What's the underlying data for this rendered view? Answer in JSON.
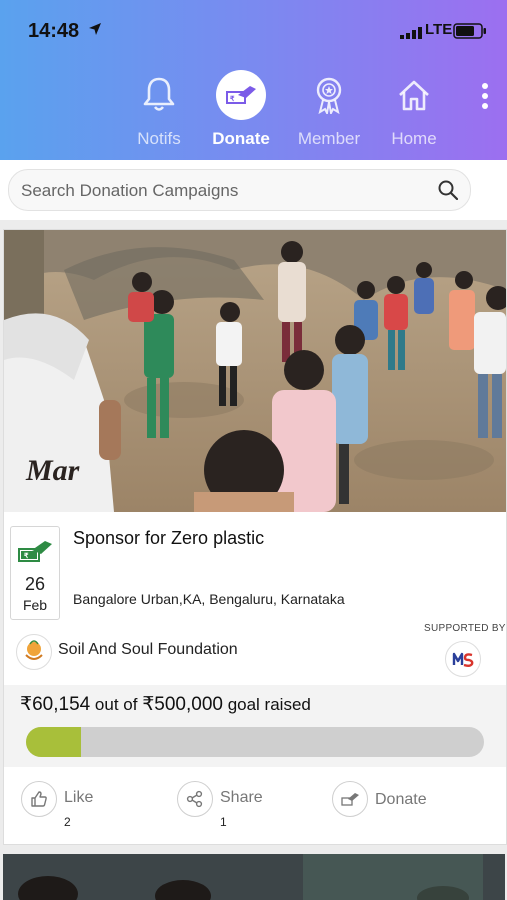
{
  "status_bar": {
    "time": "14:48",
    "network": "LTE"
  },
  "nav": {
    "items": [
      {
        "label": "Notifs",
        "icon": "bell-icon",
        "active": false
      },
      {
        "label": "Donate",
        "icon": "donate-icon",
        "active": true
      },
      {
        "label": "Member",
        "icon": "badge-icon",
        "active": false
      },
      {
        "label": "Home",
        "icon": "home-icon",
        "active": false
      }
    ],
    "more_icon": "more-vertical-icon"
  },
  "search": {
    "placeholder": "Search Donation Campaigns",
    "value": ""
  },
  "campaign": {
    "title": "Sponsor for Zero plastic",
    "date_day": "26",
    "date_month": "Feb",
    "location": "Bangalore Urban,KA, Bengaluru, Karnataka",
    "organization": "Soil And Soul Foundation",
    "supported_by_label": "SUPPORTED BY",
    "raised": {
      "amount": "₹60,154",
      "out_of": " out of ",
      "goal": "₹500,000",
      "suffix": " goal raised",
      "fraction": 0.12
    },
    "actions": {
      "like": {
        "label": "Like",
        "count": "2"
      },
      "share": {
        "label": "Share",
        "count": "1"
      },
      "donate": {
        "label": "Donate"
      }
    }
  },
  "colors": {
    "header_gradient_start": "#5aa2ee",
    "header_gradient_end": "#9c6ff0",
    "progress_fill": "#a8bf3a",
    "progress_track": "#cfcfcf"
  }
}
